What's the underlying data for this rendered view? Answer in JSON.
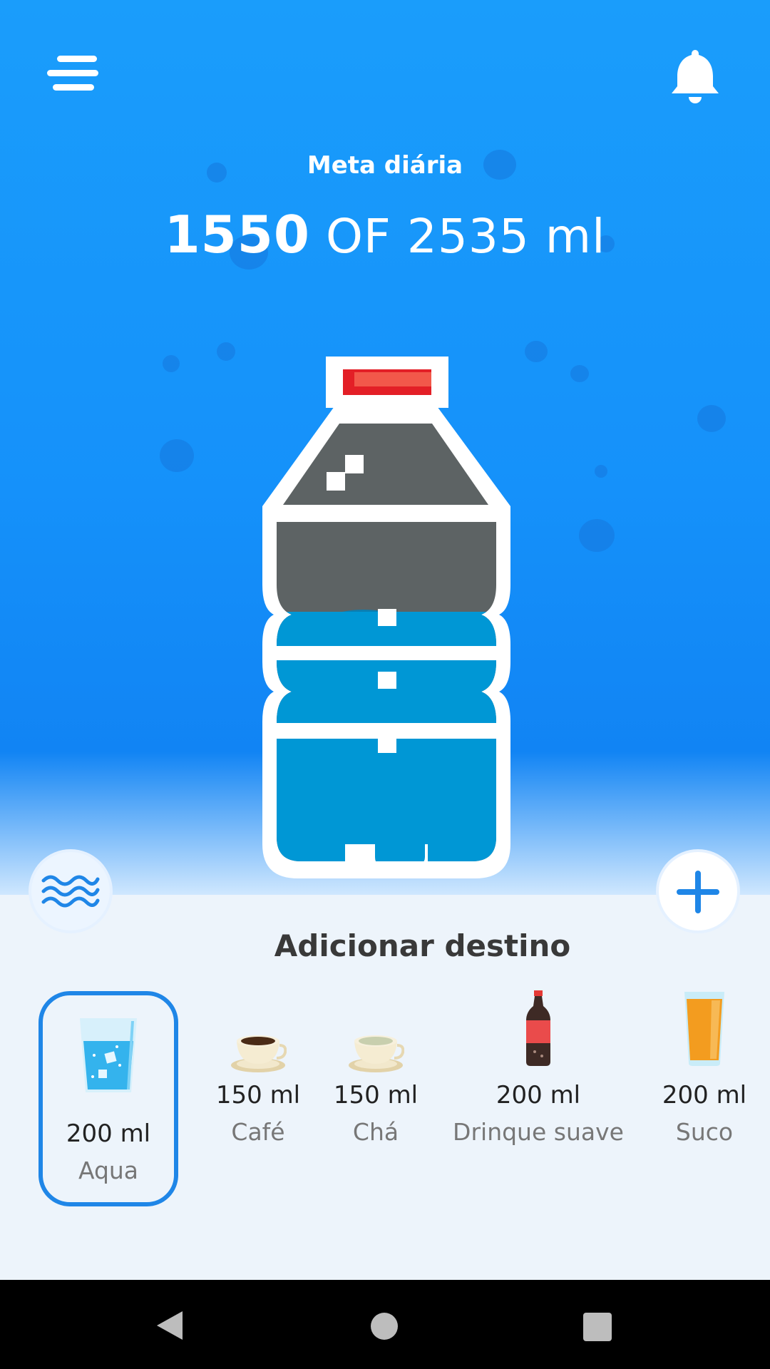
{
  "header": {
    "goal_label": "Meta diária"
  },
  "goal": {
    "current": "1550",
    "separator": "OF",
    "target": "2535",
    "unit": "ml"
  },
  "icons": {
    "menu": "hamburger-menu-icon",
    "notifications": "bell-icon",
    "waves": "waves-icon",
    "add": "plus-icon",
    "nav_back": "triangle-back-icon",
    "nav_home": "circle-home-icon",
    "nav_recents": "square-recents-icon"
  },
  "section_title": "Adicionar destino",
  "drinks": [
    {
      "amount": "200 ml",
      "name": "Aqua",
      "selected": true
    },
    {
      "amount": "150 ml",
      "name": "Café"
    },
    {
      "amount": "150 ml",
      "name": "Chá"
    },
    {
      "amount": "200 ml",
      "name": "Drinque suave"
    },
    {
      "amount": "200 ml",
      "name": "Suco"
    }
  ],
  "colors": {
    "primary": "#1a9dfb",
    "accent": "#1f86e7",
    "water": "#0097d5",
    "bottle_empty": "#5d6364",
    "cap_red": "#e31f26"
  },
  "progress": {
    "filled_fraction": 0.61
  }
}
